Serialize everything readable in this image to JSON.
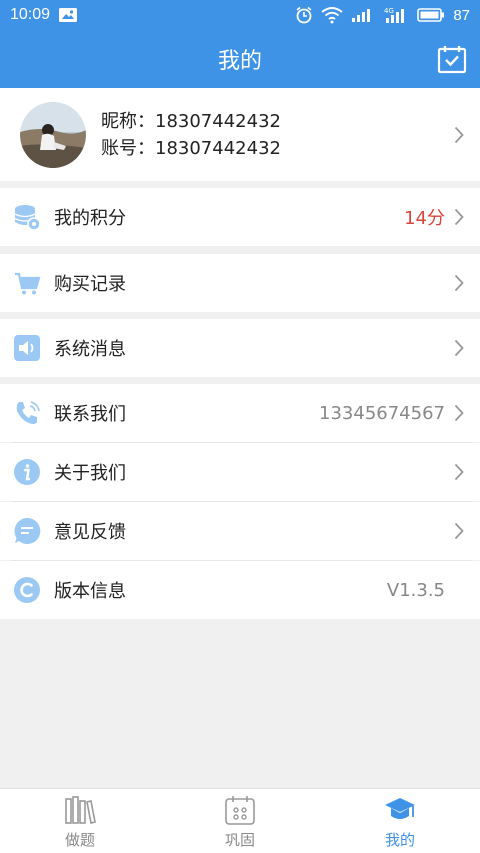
{
  "status_bar": {
    "time": "10:09",
    "battery": "87"
  },
  "header": {
    "title": "我的"
  },
  "profile": {
    "nickname_line": "昵称：18307442432",
    "account_line": "账号：18307442432"
  },
  "menu": {
    "points": {
      "label": "我的积分",
      "value": "14分"
    },
    "purchases": {
      "label": "购买记录"
    },
    "messages": {
      "label": "系统消息"
    },
    "contact": {
      "label": "联系我们",
      "value": "13345674567"
    },
    "about": {
      "label": "关于我们"
    },
    "feedback": {
      "label": "意见反馈"
    },
    "version": {
      "label": "版本信息",
      "value": "V1.3.5"
    }
  },
  "tabs": [
    {
      "label": "做题"
    },
    {
      "label": "巩固"
    },
    {
      "label": "我的"
    }
  ],
  "colors": {
    "primary": "#3f93e6",
    "accent_red": "#d9453b",
    "icon_light": "#9cc9f3"
  }
}
